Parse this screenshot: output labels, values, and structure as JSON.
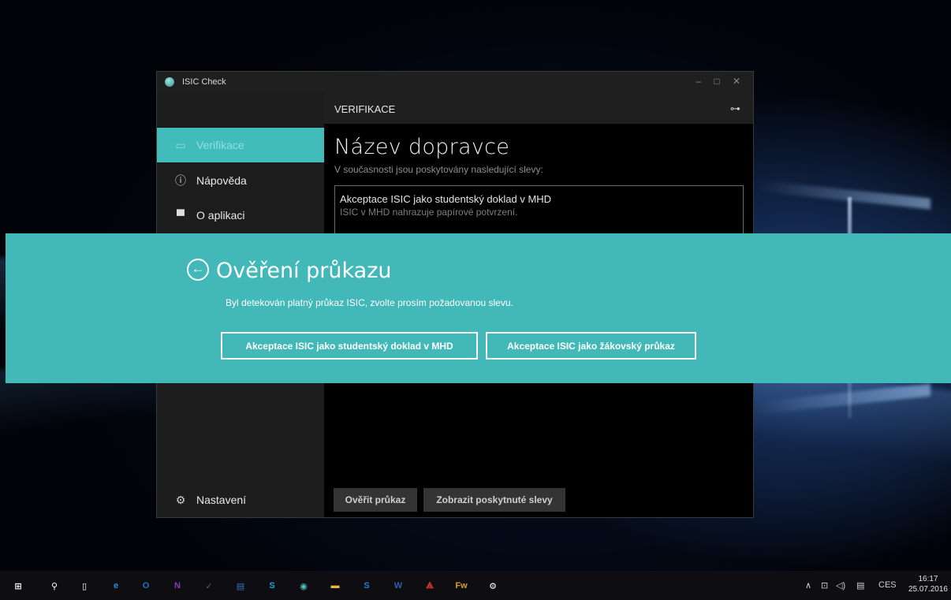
{
  "window": {
    "title": "ISIC Check",
    "controls": {
      "minimize": "–",
      "maximize": "□",
      "close": "✕"
    }
  },
  "sidebar": {
    "items": [
      {
        "label": "Verifikace",
        "icon": "card-icon",
        "glyph": "▭",
        "active": true
      },
      {
        "label": "Nápověda",
        "icon": "info-icon",
        "glyph": "ⓘ",
        "active": false
      },
      {
        "label": "O aplikaci",
        "icon": "monitor-icon",
        "glyph": "▀",
        "active": false
      }
    ],
    "settings": {
      "label": "Nastavení",
      "icon": "gear-icon",
      "glyph": "⚙"
    }
  },
  "header": {
    "title": "VERIFIKACE",
    "link_glyph": "⊶"
  },
  "content": {
    "carrier_name": "Název dopravce",
    "subtitle": "V současnosti jsou poskytovány nasledující slevy:",
    "discount": {
      "title": "Akceptace ISIC jako studentský doklad v MHD",
      "description": "ISIC v MHD nahrazuje papírové potvrzení."
    },
    "buttons": {
      "verify": "Ověřit průkaz",
      "show_discounts": "Zobrazit poskytnuté slevy"
    }
  },
  "dialog": {
    "back_glyph": "←",
    "title": "Ověření průkazu",
    "message": "Byl detekován platný průkaz ISIC, zvolte prosím požadovanou slevu.",
    "options": [
      "Akceptace ISIC jako studentský doklad v MHD",
      "Akceptace ISIC jako žákovský průkaz"
    ]
  },
  "taskbar": {
    "icons": [
      {
        "name": "start-icon",
        "glyph": "⊞",
        "color": "#ffffff"
      },
      {
        "name": "search-icon",
        "glyph": "⚲",
        "color": "#ffffff"
      },
      {
        "name": "task-view-icon",
        "glyph": "▯",
        "color": "#ffffff"
      },
      {
        "name": "edge-icon",
        "glyph": "e",
        "color": "#2b8fe0"
      },
      {
        "name": "outlook-icon",
        "glyph": "O",
        "color": "#1f6fc4"
      },
      {
        "name": "onenote-icon",
        "glyph": "N",
        "color": "#8a3ab5"
      },
      {
        "name": "project-icon",
        "glyph": "✓",
        "color": "#3a7c3a"
      },
      {
        "name": "save-icon",
        "glyph": "▤",
        "color": "#3d6fb8"
      },
      {
        "name": "skype-icon",
        "glyph": "S",
        "color": "#1fa0e0"
      },
      {
        "name": "isic-icon",
        "glyph": "◉",
        "color": "#4cc3c0"
      },
      {
        "name": "file-explorer-icon",
        "glyph": "▬",
        "color": "#e8b93a"
      },
      {
        "name": "skype-business-icon",
        "glyph": "S",
        "color": "#1d7fd6"
      },
      {
        "name": "word-icon",
        "glyph": "W",
        "color": "#2b5fb0"
      },
      {
        "name": "acrobat-icon",
        "glyph": "⟁",
        "color": "#d83b2a"
      },
      {
        "name": "fireworks-icon",
        "glyph": "Fw",
        "color": "#d6a01e"
      },
      {
        "name": "settings-icon",
        "glyph": "⚙",
        "color": "#ffffff"
      }
    ],
    "tray": {
      "chevron": "∧",
      "network": "⊡",
      "volume": "◁)",
      "notification": "▤",
      "language": "CES"
    },
    "clock": {
      "time": "16:17",
      "date": "25.07.2016"
    }
  }
}
